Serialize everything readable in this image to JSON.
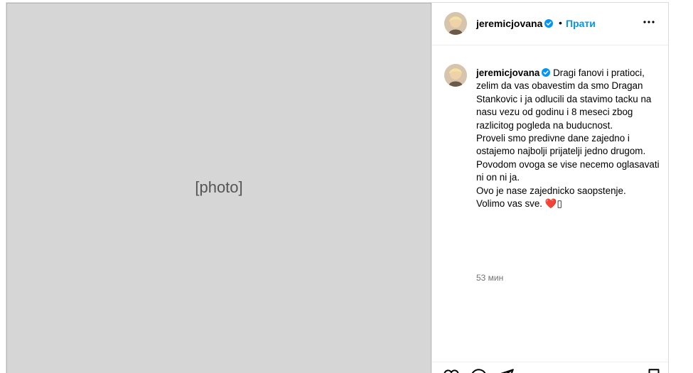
{
  "post": {
    "username": "jeremicjovana",
    "verified": true,
    "follow_label": "Прати",
    "photo": {
      "placeholder": "[photo]"
    }
  },
  "caption": {
    "username": "jeremicjovana",
    "lines": [
      "Dragi fanovi i pratioci, zelim da vas obavestim da smo Dragan Stankovic i ja odlucili da stavimo tacku na nasu vezu od godinu i 8 meseci zbog razlicitog pogleda na buducnost.",
      "Proveli smo predivne dane zajedno i ostajemo najbolji prijatelji jedno drugom.",
      "Povodom ovoga se vise necemo oglasavati ni on ni ja.",
      "Ovo je nase zajednicko saopstenje.",
      "Volimo vas sve."
    ],
    "emoji": "❤️",
    "extra_glyph": "▯",
    "timestamp": "53 мин"
  },
  "icons": {
    "verified": "verified-badge-icon",
    "more": "more-options-icon",
    "like": "heart-icon",
    "comment": "comment-icon",
    "share": "share-icon",
    "save": "bookmark-icon"
  },
  "colors": {
    "accent": "#0095f6",
    "verified": "#0095f6",
    "muted": "#737373",
    "heart": "#e01f3d"
  }
}
